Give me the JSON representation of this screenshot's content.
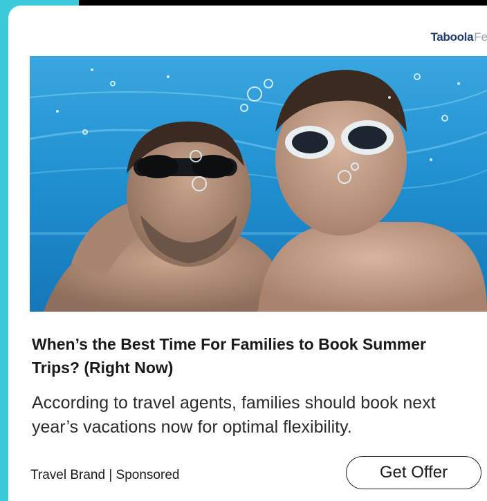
{
  "brand": {
    "taboola": "Taboola",
    "feed": "Feed"
  },
  "hero_image": {
    "description_icon": "underwater-family-photo"
  },
  "ad": {
    "headline": "When’s the Best Time For Families to Book Summer Trips? (Right Now)",
    "description": "According to travel agents, families should book next year’s vacations now for optimal flexibility.",
    "attribution": "Travel Brand | Sponsored",
    "cta_label": "Get Offer"
  },
  "colors": {
    "accent": "#3cc9d9",
    "brand_blue": "#1c3a6e",
    "water": "#1f8fd0"
  }
}
